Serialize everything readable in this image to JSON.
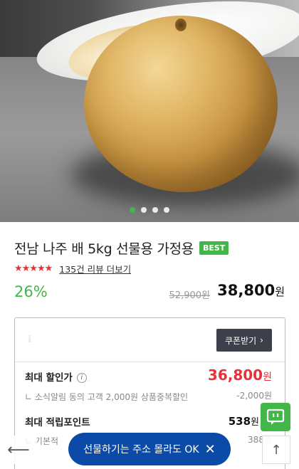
{
  "hero": {
    "slides_total": 4,
    "active_slide": 1
  },
  "product": {
    "title": "전남 나주 배 5kg 선물용 가정용",
    "badge": "BEST",
    "stars": "★★★★★",
    "rating": 4.5,
    "review_link": "135건 리뷰 더보기",
    "discount": "26%",
    "original_price": "52,900원",
    "final_price": "38,800",
    "currency": "원"
  },
  "benefits": {
    "coupon_button": "쿠폰받기",
    "max_discount_label": "최대 할인가",
    "max_discount_value": "36,800",
    "currency": "원",
    "sub_label": "소식알림 동의 고객 2,000원 상품중복할인",
    "sub_value": "-2,000원",
    "points_label": "최대 적립포인트",
    "points_value": "538",
    "points_sub_label": "기본적",
    "points_sub_value": "388원"
  },
  "toast": {
    "text": "선물하기는 주소 몰라도 OK",
    "close": "✕"
  },
  "colors": {
    "accent": "#43b649",
    "sale_red": "#e8323a",
    "toast_blue": "#0b4aa6"
  }
}
